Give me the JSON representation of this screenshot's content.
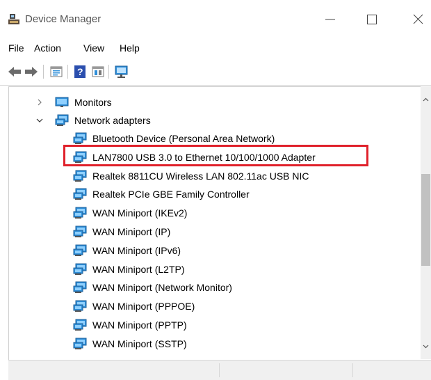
{
  "window": {
    "title": "Device Manager",
    "minimize_glyph": "—",
    "maximize_glyph": "☐",
    "close_glyph": "✕"
  },
  "menu": {
    "items": [
      "File",
      "Action",
      "View",
      "Help"
    ]
  },
  "toolbar": {
    "buttons": [
      "back-icon",
      "forward-icon",
      "properties-icon",
      "help-icon",
      "device-view-icon",
      "scan-hardware-icon"
    ]
  },
  "tree": {
    "monitors": {
      "label": "Monitors",
      "expanded": false
    },
    "network_adapters": {
      "label": "Network adapters",
      "expanded": true,
      "children": [
        "Bluetooth Device (Personal Area Network)",
        "LAN7800 USB 3.0 to Ethernet 10/100/1000 Adapter",
        "Realtek 8811CU Wireless LAN 802.11ac USB NIC",
        "Realtek PCIe GBE Family Controller",
        "WAN Miniport (IKEv2)",
        "WAN Miniport (IP)",
        "WAN Miniport (IPv6)",
        "WAN Miniport (L2TP)",
        "WAN Miniport (Network Monitor)",
        "WAN Miniport (PPPOE)",
        "WAN Miniport (PPTP)",
        "WAN Miniport (SSTP)"
      ]
    },
    "highlighted_item": "LAN7800 USB 3.0 to Ethernet 10/100/1000 Adapter"
  },
  "colors": {
    "highlight_border": "#e0212b",
    "adapter_icon": "#2f8fd8"
  }
}
